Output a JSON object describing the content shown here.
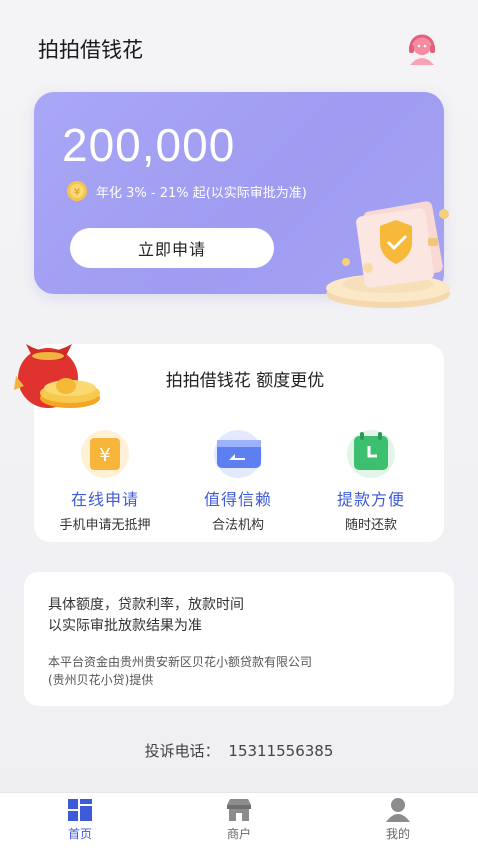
{
  "header": {
    "title": "拍拍借钱花",
    "support_icon": "customer-service-icon"
  },
  "hero": {
    "amount": "200,000",
    "rate_text": "年化 3% - 21% 起(以实际审批为准)",
    "apply_label": "立即申请"
  },
  "features": {
    "title": "拍拍借钱花 额度更优",
    "items": [
      {
        "name": "在线申请",
        "desc": "手机申请无抵押",
        "icon": "yuan-tag-icon"
      },
      {
        "name": "值得信赖",
        "desc": "合法机构",
        "icon": "card-icon"
      },
      {
        "name": "提款方便",
        "desc": "随时还款",
        "icon": "calendar-clock-icon"
      }
    ]
  },
  "info": {
    "line1": "具体额度，贷款利率，放款时间",
    "line2": "以实际审批放款结果为准",
    "line3": "本平台资金由贵州贵安新区贝花小额贷款有限公司",
    "line4": "(贵州贝花小贷)提供"
  },
  "complaint": {
    "label": "投诉电话：",
    "phone": "15311556385"
  },
  "tabbar": {
    "tabs": [
      {
        "label": "首页",
        "icon": "home-icon",
        "active": true
      },
      {
        "label": "商户",
        "icon": "shop-icon",
        "active": false
      },
      {
        "label": "我的",
        "icon": "user-icon",
        "active": false
      }
    ]
  },
  "colors": {
    "accent": "#3f5ad8",
    "hero": "#a3a1f4",
    "active_tab": "#3f5ad8",
    "inactive_tab": "#666666"
  }
}
